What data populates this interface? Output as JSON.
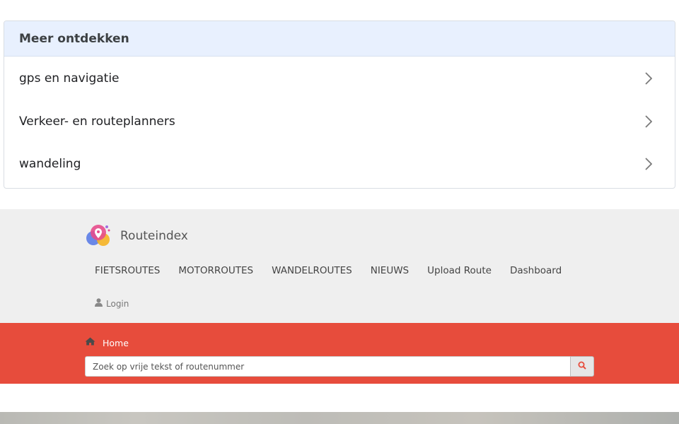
{
  "discover": {
    "title": "Meer ontdekken",
    "items": [
      {
        "label": "gps en navigatie"
      },
      {
        "label": "Verkeer- en routeplanners"
      },
      {
        "label": "wandeling"
      }
    ]
  },
  "header": {
    "brand": "Routeindex",
    "nav": [
      {
        "label": "FIETSROUTES"
      },
      {
        "label": "MOTORROUTES"
      },
      {
        "label": "WANDELROUTES"
      },
      {
        "label": "NIEUWS"
      },
      {
        "label": "Upload Route"
      },
      {
        "label": "Dashboard"
      }
    ],
    "login_label": "Login"
  },
  "redbar": {
    "breadcrumb_home": "Home",
    "search_placeholder": "Zoek op vrije tekst of routenummer"
  },
  "colors": {
    "accent_red": "#e74c3c",
    "header_gray": "#efefef",
    "discover_header_bg": "#e8f0fe"
  },
  "icons": {
    "chevron": "chevron-right-icon",
    "logo": "location-pin-logo",
    "login": "user-icon",
    "home": "home-icon",
    "search": "search-icon"
  }
}
